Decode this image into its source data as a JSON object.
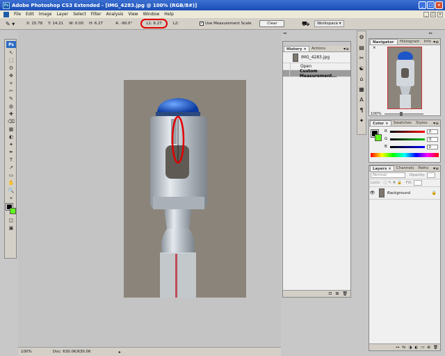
{
  "window": {
    "title": "Adobe Photoshop CS3 Extended - [IMG_4283.jpg @ 100% (RGB/8#)]",
    "app_icon": "Ps",
    "minimize": "_",
    "maximize": "□",
    "close": "×"
  },
  "menu": [
    "File",
    "Edit",
    "Image",
    "Layer",
    "Select",
    "Filter",
    "Analysis",
    "View",
    "Window",
    "Help"
  ],
  "doc_controls": {
    "minimize": "_",
    "restore": "□",
    "close": "×"
  },
  "options": {
    "tool_icon": "✎ ▾",
    "x": "X: 15.78",
    "y": "Y: 14.21",
    "w": "W: 0.00",
    "h": "H: 6.27",
    "angle": "A: -90.0°",
    "l1": "L1: 6.27",
    "l2": "L2:",
    "use_measurement_scale": "Use Measurement Scale",
    "clear": "Clear",
    "workspace": "Workspace ▾"
  },
  "toolbox": {
    "logo": "Ps",
    "tools": [
      "↖",
      "⬚",
      "ʘ",
      "✥",
      "⌗",
      "✂",
      "✎",
      "◍",
      "✚",
      "⌫",
      "▦",
      "◐",
      "✦",
      "✒",
      "T",
      "↗",
      "▭",
      "✋",
      "🔍",
      "⌖",
      "◫",
      "▣"
    ]
  },
  "status": {
    "zoom": "100%",
    "doc": "Doc: 630.0K/630.0K",
    "arrow": "▸"
  },
  "history": {
    "tabs": [
      "History ×",
      "Actions"
    ],
    "snapshot": "IMG_4283.jpg",
    "items": [
      "Open",
      "Custom Measurement..."
    ],
    "menu": "▾≡",
    "footer": [
      "⊡",
      "⊞",
      "🗑"
    ]
  },
  "navigator": {
    "tabs": [
      "Navigator ×",
      "Histogram",
      "Info"
    ],
    "zoom": "100%",
    "menu": "▾≡"
  },
  "color": {
    "tabs": [
      "Color ×",
      "Swatches",
      "Styles"
    ],
    "channels": [
      {
        "name": "R",
        "value": "0",
        "gradient": "#ff0000"
      },
      {
        "name": "G",
        "value": "0",
        "gradient": "#00c000"
      },
      {
        "name": "B",
        "value": "0",
        "gradient": "#0000ff"
      }
    ],
    "fg": "#000000",
    "bg": "#5dfb1a",
    "menu": "▾≡"
  },
  "layers": {
    "tabs": [
      "Layers ×",
      "Channels",
      "Paths"
    ],
    "blend_mode": "Normal",
    "opacity_label": "Opacity:",
    "lock_label": "Lock:",
    "fill_label": "Fill:",
    "layer_name": "Background",
    "footer": [
      "⊶",
      "fx",
      "◑",
      "◐",
      "▭",
      "⊞",
      "🗑"
    ],
    "menu": "▾≡"
  },
  "iconcol": [
    "⚙",
    "▤",
    "✂",
    "☯",
    "⌂",
    "▦",
    "A",
    "¶",
    "✦"
  ]
}
